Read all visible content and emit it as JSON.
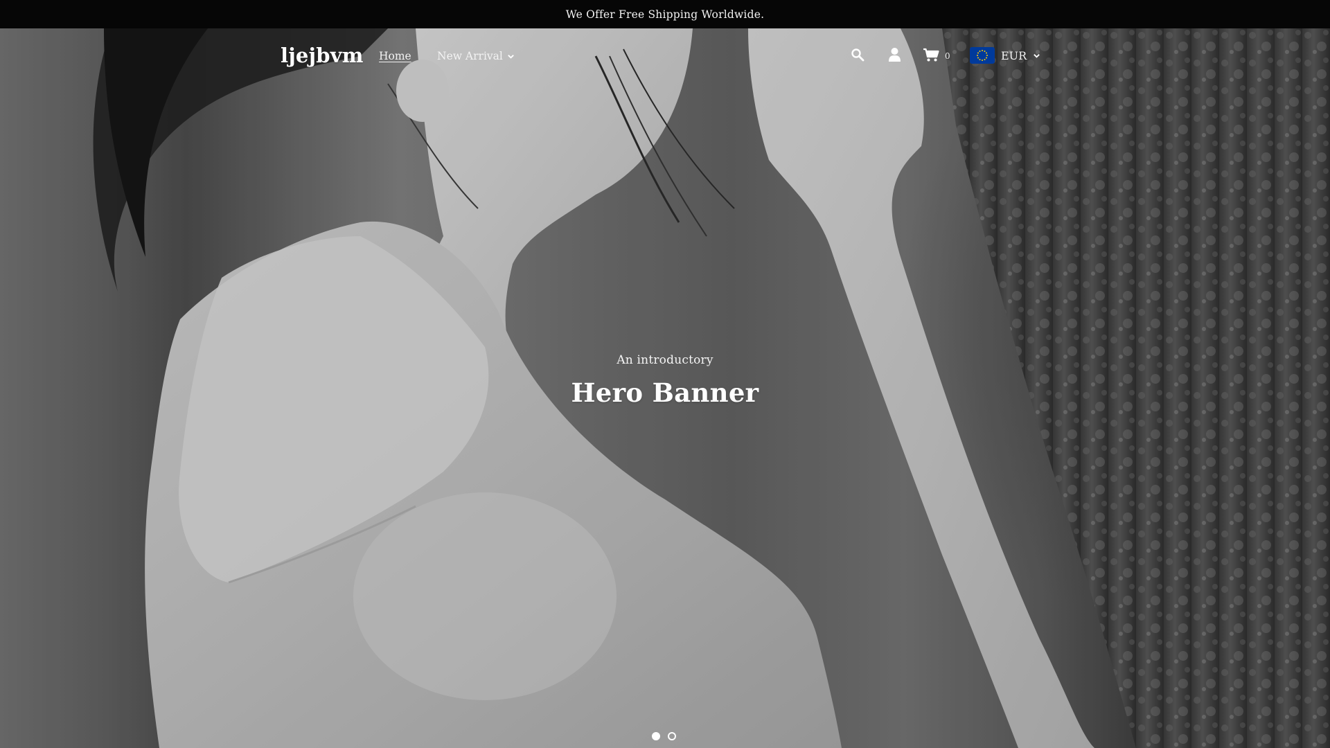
{
  "announcement": {
    "text": "We Offer Free Shipping Worldwide."
  },
  "header": {
    "logo": "ljejbvm",
    "nav": {
      "home_label": "Home",
      "new_arrival_label": "New Arrival"
    },
    "icons": [
      "search-icon",
      "user-icon",
      "cart-icon"
    ],
    "cart_count": "0",
    "currency": {
      "label": "EUR",
      "flag": "eu-flag-icon"
    }
  },
  "hero": {
    "subtitle": "An introductory",
    "title": "Hero Banner",
    "slides_total": 2,
    "active_slide": 1
  },
  "colors": {
    "announcement_bg": "#060606",
    "text": "#ffffff",
    "flag_blue": "#003a9b",
    "flag_stars": "#ffcc00"
  }
}
